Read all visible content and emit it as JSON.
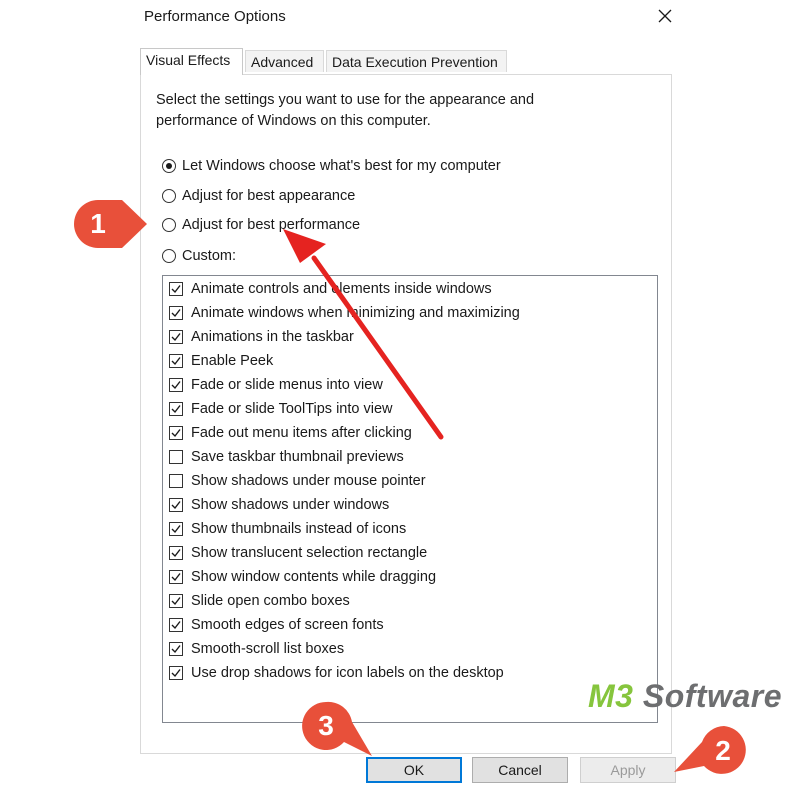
{
  "window": {
    "title": "Performance Options"
  },
  "tabs": [
    {
      "label": "Visual Effects",
      "active": true
    },
    {
      "label": "Advanced",
      "active": false
    },
    {
      "label": "Data Execution Prevention",
      "active": false
    }
  ],
  "description": "Select the settings you want to use for the appearance and performance of Windows on this computer.",
  "radios": [
    {
      "label": "Let Windows choose what's best for my computer",
      "checked": true
    },
    {
      "label": "Adjust for best appearance",
      "checked": false
    },
    {
      "label": "Adjust for best performance",
      "checked": false
    },
    {
      "label": "Custom:",
      "checked": false
    }
  ],
  "effects": [
    {
      "label": "Animate controls and elements inside windows",
      "checked": true
    },
    {
      "label": "Animate windows when minimizing and maximizing",
      "checked": true
    },
    {
      "label": "Animations in the taskbar",
      "checked": true
    },
    {
      "label": "Enable Peek",
      "checked": true
    },
    {
      "label": "Fade or slide menus into view",
      "checked": true
    },
    {
      "label": "Fade or slide ToolTips into view",
      "checked": true
    },
    {
      "label": "Fade out menu items after clicking",
      "checked": true
    },
    {
      "label": "Save taskbar thumbnail previews",
      "checked": false
    },
    {
      "label": "Show shadows under mouse pointer",
      "checked": false
    },
    {
      "label": "Show shadows under windows",
      "checked": true
    },
    {
      "label": "Show thumbnails instead of icons",
      "checked": true
    },
    {
      "label": "Show translucent selection rectangle",
      "checked": true
    },
    {
      "label": "Show window contents while dragging",
      "checked": true
    },
    {
      "label": "Slide open combo boxes",
      "checked": true
    },
    {
      "label": "Smooth edges of screen fonts",
      "checked": true
    },
    {
      "label": "Smooth-scroll list boxes",
      "checked": true
    },
    {
      "label": "Use drop shadows for icon labels on the desktop",
      "checked": true
    }
  ],
  "buttons": {
    "ok": "OK",
    "cancel": "Cancel",
    "apply": "Apply"
  },
  "annotations": {
    "step1": "1",
    "step2": "2",
    "step3": "3",
    "badge_color": "#e8503a",
    "arrow_color": "#e52320"
  },
  "watermark": {
    "part1": "M3",
    "part2": " Software"
  }
}
